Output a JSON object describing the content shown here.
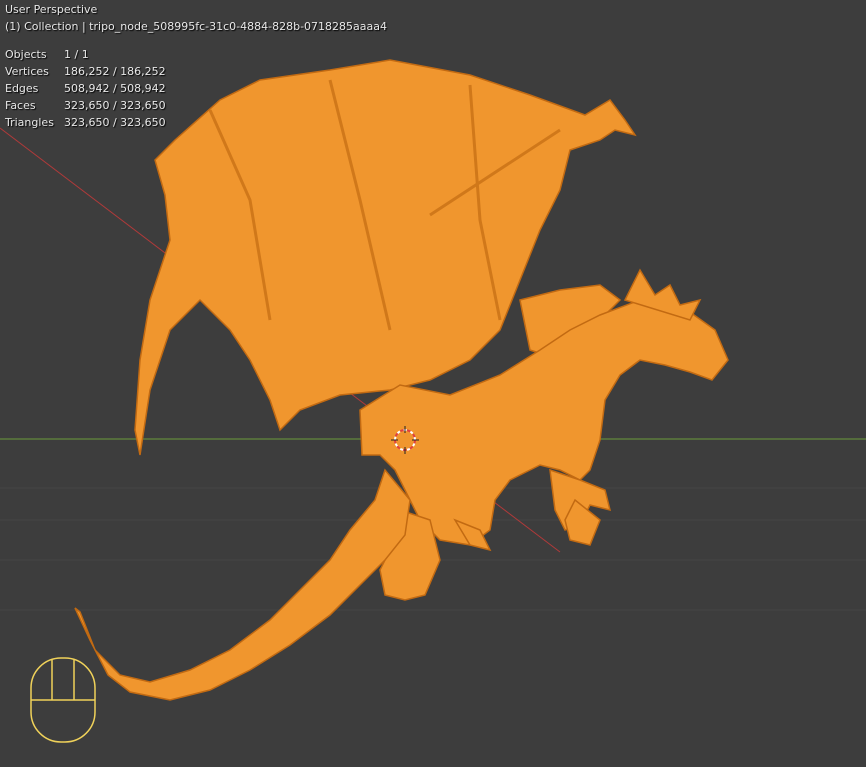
{
  "viewport": {
    "view_name": "User Perspective",
    "collection_line": "(1) Collection | tripo_node_508995fc-31c0-4884-828b-0718285aaaa4"
  },
  "stats": [
    {
      "label": "Objects",
      "value": "1 / 1"
    },
    {
      "label": "Vertices",
      "value": "186,252 / 186,252"
    },
    {
      "label": "Edges",
      "value": "508,942 / 508,942"
    },
    {
      "label": "Faces",
      "value": "323,650 / 323,650"
    },
    {
      "label": "Triangles",
      "value": "323,650 / 323,650"
    }
  ],
  "colors": {
    "background": "#3d3d3d",
    "mesh_selected": "#f0962e",
    "x_axis": "#b03a3a",
    "y_axis": "#6a9a3a",
    "mouse_hint": "#f0d25a"
  },
  "icons": [
    "3d-cursor-icon",
    "mouse-icon"
  ]
}
